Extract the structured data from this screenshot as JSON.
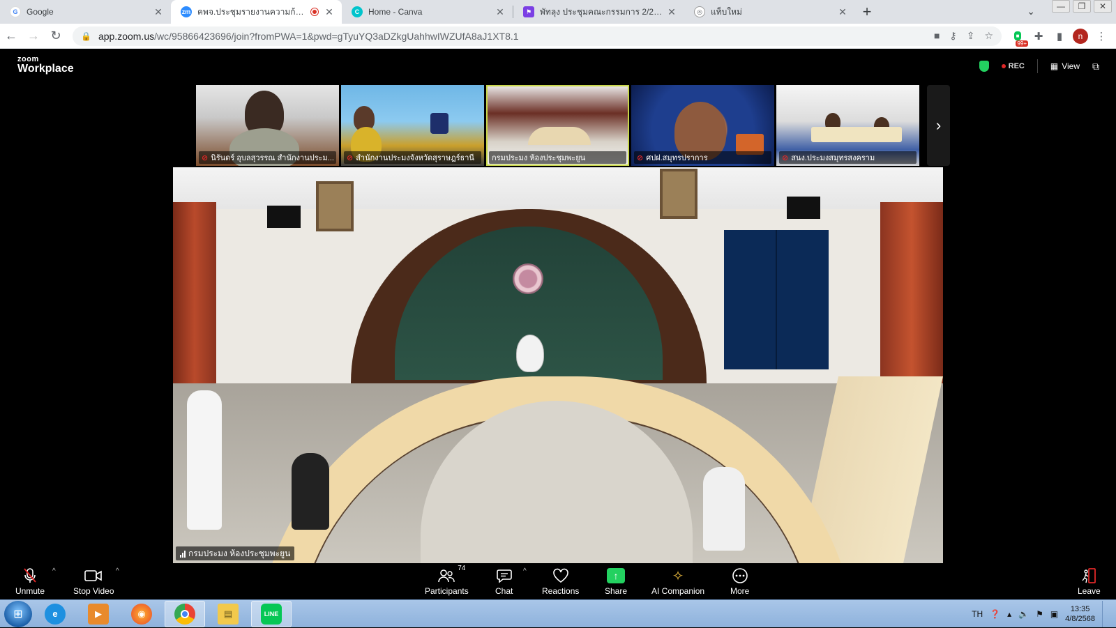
{
  "browser": {
    "tabs": [
      {
        "title": "Google",
        "favicon": "G",
        "color": "#4285f4",
        "active": false
      },
      {
        "title": "คพจ.ประชุมรายงานความก้าวหน้",
        "favicon": "zm",
        "color": "#2d8cff",
        "active": true,
        "recording": true
      },
      {
        "title": "Home - Canva",
        "favicon": "C",
        "color": "#00c4cc",
        "active": false
      },
      {
        "title": "พัทลุง ประชุมคณะกรรมการ 2/2568 -",
        "favicon": "⚑",
        "color": "#7b3fe4",
        "active": false
      },
      {
        "title": "แท็บใหม่",
        "favicon": "◎",
        "color": "#5f6368",
        "active": false
      }
    ],
    "new_tab": "+",
    "url_host": "app.zoom.us",
    "url_path": "/wc/95866423696/join?fromPWA=1&pwd=gTyuYQ3aDZkgUahhwIWZUfA8aJ1XT8.1",
    "extension_badge": "99+",
    "profile_initial": "n"
  },
  "zoom": {
    "brand_small": "zoom",
    "brand_large": "Workplace",
    "rec_label": "REC",
    "view_label": "View",
    "thumbnails": [
      {
        "name": "นิรันดร์ อุบลสุวรรณ สำนักงานประม..."
      },
      {
        "name": "สำนักงานประมงจังหวัดสุราษฎร์ธานี"
      },
      {
        "name": "กรมประมง ห้องประชุมพะยูน"
      },
      {
        "name": "ศปฝ.สมุทรปราการ"
      },
      {
        "name": "สนง.ประมงสมุทรสงคราม"
      }
    ],
    "main_speaker_label": "กรมประมง ห้องประชุมพะยูน",
    "controls": {
      "unmute": "Unmute",
      "stop_video": "Stop Video",
      "participants": "Participants",
      "participants_count": "74",
      "chat": "Chat",
      "reactions": "Reactions",
      "share": "Share",
      "ai_companion": "AI Companion",
      "more": "More",
      "leave": "Leave"
    }
  },
  "taskbar": {
    "language": "TH",
    "time": "13:35",
    "date": "4/8/2568",
    "line_label": "LINE"
  }
}
